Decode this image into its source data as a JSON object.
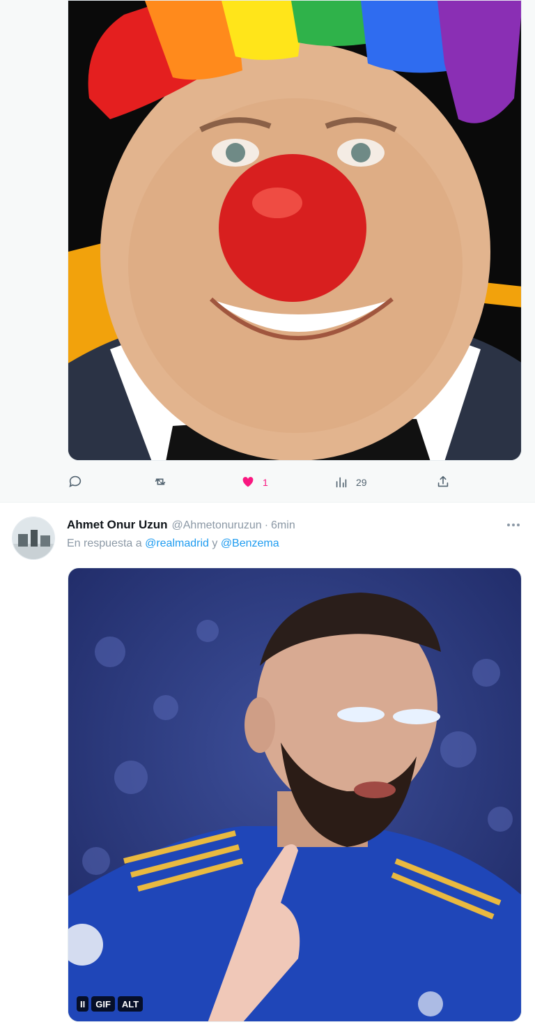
{
  "tweet1": {
    "actions": {
      "reply_count": "",
      "retweet_count": "",
      "like_count": "1",
      "views_count": "29"
    },
    "icons": {
      "reply": "reply-bubble-icon",
      "retweet": "retweet-icon",
      "like": "heart-icon",
      "views": "views-chart-icon",
      "share": "share-icon"
    },
    "colors": {
      "like_active": "#f91880"
    }
  },
  "tweet2": {
    "author_name": "Ahmet Onur Uzun",
    "author_handle": "@Ahmetonuruzun",
    "separator": "·",
    "time": "6min",
    "reply_prefix": "En respuesta a",
    "reply_mention_1": "@realmadrid",
    "reply_conjunction": "y",
    "reply_mention_2": "@Benzema",
    "media_badges": {
      "pause": "II",
      "gif": "GIF",
      "alt": "ALT"
    }
  },
  "colors": {
    "accent": "#1d9bf0",
    "muted_text": "#8b98a5",
    "background_top": "#f7f9f9"
  }
}
